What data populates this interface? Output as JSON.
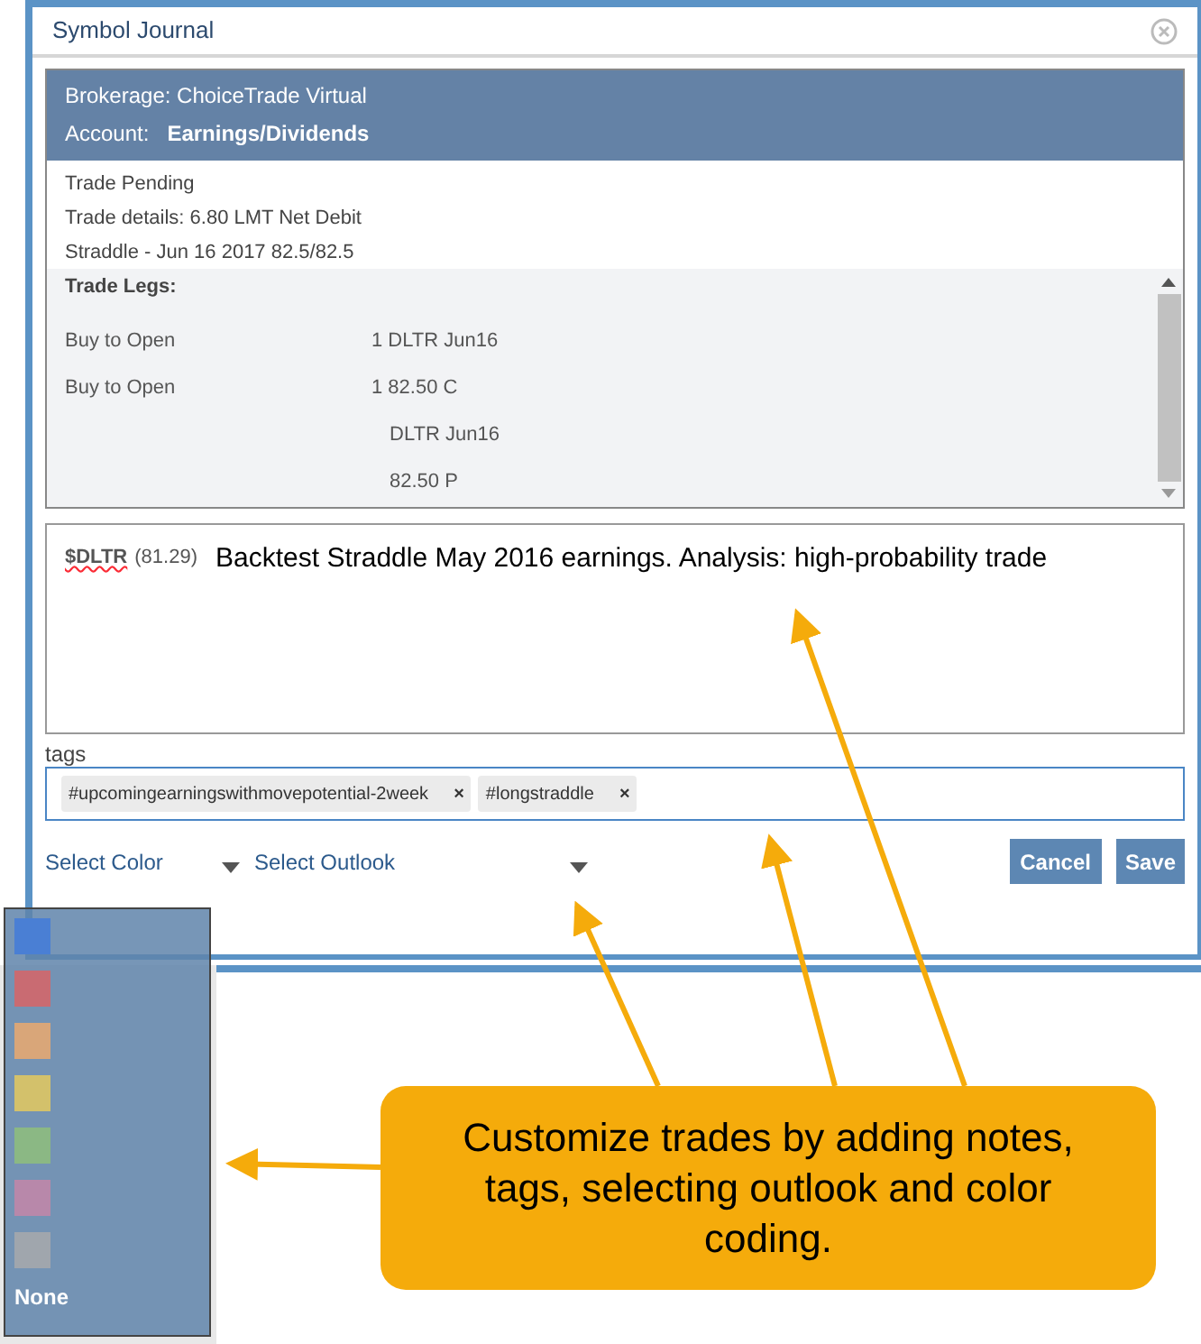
{
  "dialog": {
    "title": "Symbol Journal",
    "brokerage": "Brokerage: ChoiceTrade Virtual",
    "account_label": "Account:",
    "account": "Earnings/Dividends",
    "info": [
      "Trade Pending",
      "Trade details: 6.80 LMT Net Debit",
      "Straddle - Jun 16 2017 82.5/82.5"
    ],
    "legs_title": "Trade Legs:",
    "legs": [
      {
        "action": "Buy to Open",
        "details": [
          "1 DLTR Jun16"
        ]
      },
      {
        "action": "Buy to Open",
        "details": [
          "1 82.50 C",
          "DLTR Jun16",
          "82.50 P"
        ]
      }
    ],
    "note": {
      "symbol": "$DLTR",
      "price": "(81.29)",
      "text": "Backtest Straddle May 2016 earnings. Analysis: high-probability trade"
    },
    "tags_label": "tags",
    "tags": [
      "#upcomingearningswithmovepotential-2week",
      "#longstraddle"
    ],
    "tag_remove": "×",
    "selects": [
      "Select Color",
      "Select Outlook"
    ],
    "buttons": [
      "Cancel",
      "Save"
    ]
  },
  "color_menu": {
    "options": [
      {
        "color": "#4a7fd4"
      },
      {
        "color": "#c96b72"
      },
      {
        "color": "#d9a679"
      },
      {
        "color": "#d3c16b"
      },
      {
        "color": "#8bb884"
      },
      {
        "color": "#b888aa"
      },
      {
        "color": "#a0a6ad"
      }
    ],
    "none_label": "None"
  },
  "callout": {
    "text": "Customize trades by adding notes, tags, selecting outlook and color coding."
  }
}
